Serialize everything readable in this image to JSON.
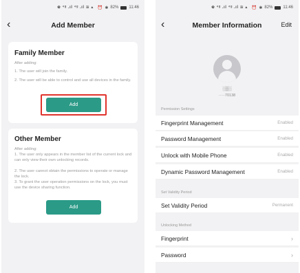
{
  "status_bar": {
    "signal": "᪤ ⁴ᵍ .ıl  ⁴ᵍ .ıl ≋ ▴",
    "alarm": "⏰",
    "bluetooth": "✱",
    "battery": "82%",
    "time": "11:46"
  },
  "left": {
    "title": "Add Member",
    "family": {
      "title": "Family Member",
      "after": "After adding:",
      "p1": "1. The user will join the family.",
      "p2": "2. The user will be able to control and use all devices in the family.",
      "button": "Add"
    },
    "other": {
      "title": "Other Member",
      "after": "After adding:",
      "p1": "1. The user only appears in the member list of the current lock and can only view their own unlocking records.",
      "p2": "2. The user cannot obtain the permissions to operate or manage the lock.",
      "p3": "3. To grant the user operation permissions on the lock, you must use the device sharing function.",
      "button": "Add"
    }
  },
  "right": {
    "title": "Member Information",
    "edit": "Edit",
    "profile": {
      "name": "░▒░",
      "phone": "·····70138"
    },
    "permission_header": "Permission Settings",
    "permissions": [
      {
        "label": "Fingerprint Management",
        "value": "Enabled"
      },
      {
        "label": "Password Management",
        "value": "Enabled"
      },
      {
        "label": "Unlock with Mobile Phone",
        "value": "Enabled"
      },
      {
        "label": "Dynamic Password Management",
        "value": "Enabled"
      }
    ],
    "validity_header": "Set Validity Period",
    "validity": {
      "label": "Set Validity Period",
      "value": "Permanent"
    },
    "unlock_header": "Unlocking Method",
    "methods": [
      {
        "label": "Fingerprint"
      },
      {
        "label": "Password"
      }
    ]
  },
  "icons": {
    "back": "chevron-left-icon",
    "chevron": "chevron-right-icon"
  },
  "colors": {
    "accent": "#2b9a87",
    "highlight": "#e0322b",
    "background": "#f2f2f4"
  }
}
